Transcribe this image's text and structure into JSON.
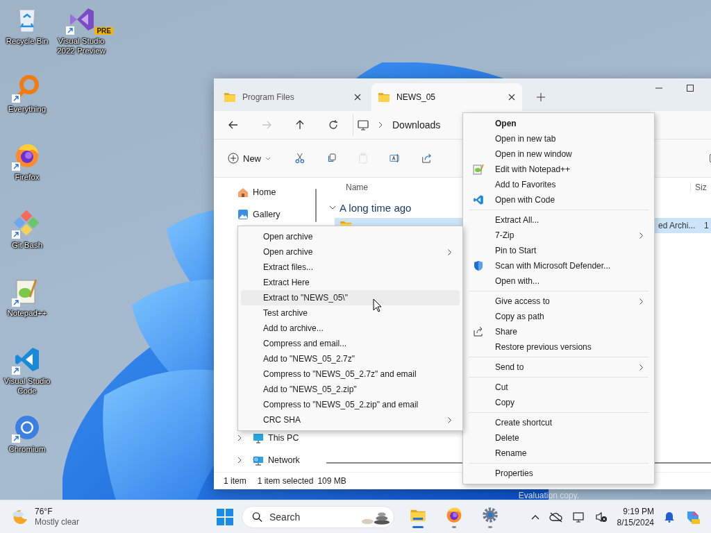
{
  "desktop": {
    "columns": [
      [
        {
          "label": "Recycle Bin",
          "kind": "recycle",
          "shortcut": false
        },
        {
          "label": "Everything",
          "kind": "everything",
          "shortcut": true
        },
        {
          "label": "Firefox",
          "kind": "firefox",
          "shortcut": true
        },
        {
          "label": "Git Bash",
          "kind": "git",
          "shortcut": true
        },
        {
          "label": "Notepad++",
          "kind": "notepad",
          "shortcut": true
        },
        {
          "label": "Visual Studio Code",
          "kind": "vscode",
          "shortcut": true
        },
        {
          "label": "Chromium",
          "kind": "chromium",
          "shortcut": true
        }
      ],
      [
        {
          "label": "Visual Studio 2022 Preview",
          "kind": "vs",
          "shortcut": true,
          "badge": "PRE"
        }
      ]
    ],
    "watermark": "Evaluation copy."
  },
  "explorer": {
    "tabs": [
      {
        "label": "Program Files",
        "selected": false
      },
      {
        "label": "NEWS_05",
        "selected": true
      }
    ],
    "nav_buttons": [
      {
        "kind": "back",
        "disabled": false
      },
      {
        "kind": "forward",
        "disabled": true
      },
      {
        "kind": "up",
        "disabled": false
      },
      {
        "kind": "refresh",
        "disabled": false
      }
    ],
    "crumbs": [
      "Downloads"
    ],
    "toolbar": {
      "new": "New",
      "tools": [
        {
          "kind": "cut",
          "disabled": false
        },
        {
          "kind": "copy",
          "disabled": false
        },
        {
          "kind": "paste",
          "disabled": true
        },
        {
          "kind": "rename",
          "disabled": false
        },
        {
          "kind": "share",
          "disabled": false
        }
      ]
    },
    "nav": {
      "top": [
        {
          "label": "Home",
          "kind": "home"
        },
        {
          "label": "Gallery",
          "kind": "gallery"
        }
      ],
      "bottom": [
        {
          "label": "This PC",
          "kind": "pc"
        },
        {
          "label": "Network",
          "kind": "network"
        }
      ]
    },
    "list": {
      "columns": [
        "Name",
        "Siz"
      ],
      "group": {
        "label": "A long time ago",
        "expanded": true
      },
      "rows": [
        {
          "type": "ed Archi...",
          "size": "1",
          "selected": true
        }
      ]
    },
    "status": [
      "1 item",
      "1 item selected",
      "109 MB"
    ]
  },
  "context_menu": {
    "items": [
      {
        "label": "Open",
        "kind": "default"
      },
      {
        "label": "Open in new tab",
        "kind": "item"
      },
      {
        "label": "Open in new window",
        "kind": "item"
      },
      {
        "label": "Edit with Notepad++",
        "kind": "item"
      },
      {
        "label": "Add to Favorites",
        "kind": "item"
      },
      {
        "label": "Open with Code",
        "kind": "item"
      },
      {
        "kind": "separator"
      },
      {
        "label": "Extract All...",
        "kind": "item"
      },
      {
        "label": "7-Zip",
        "kind": "submenu"
      },
      {
        "label": "Pin to Start",
        "kind": "item"
      },
      {
        "label": "Scan with Microsoft Defender...",
        "kind": "item"
      },
      {
        "label": "Open with...",
        "kind": "item"
      },
      {
        "kind": "separator"
      },
      {
        "label": "Give access to",
        "kind": "submenu"
      },
      {
        "label": "Copy as path",
        "kind": "item"
      },
      {
        "label": "Share",
        "kind": "item"
      },
      {
        "label": "Restore previous versions",
        "kind": "item"
      },
      {
        "kind": "separator"
      },
      {
        "label": "Send to",
        "kind": "submenu"
      },
      {
        "kind": "separator"
      },
      {
        "label": "Cut",
        "kind": "item"
      },
      {
        "label": "Copy",
        "kind": "item"
      },
      {
        "kind": "separator"
      },
      {
        "label": "Create shortcut",
        "kind": "item"
      },
      {
        "label": "Delete",
        "kind": "item"
      },
      {
        "label": "Rename",
        "kind": "item"
      },
      {
        "kind": "separator"
      },
      {
        "label": "Properties",
        "kind": "item"
      }
    ]
  },
  "zip_submenu": {
    "items": [
      {
        "label": "Open archive",
        "kind": "item",
        "selected": false
      },
      {
        "label": "Open archive",
        "kind": "submenu",
        "selected": false
      },
      {
        "label": "Extract files...",
        "kind": "item",
        "selected": false
      },
      {
        "label": "Extract Here",
        "kind": "item",
        "selected": false
      },
      {
        "label": "Extract to \"NEWS_05\\\"",
        "kind": "item",
        "selected": true
      },
      {
        "label": "Test archive",
        "kind": "item",
        "selected": false
      },
      {
        "label": "Add to archive...",
        "kind": "item",
        "selected": false
      },
      {
        "label": "Compress and email...",
        "kind": "item",
        "selected": false
      },
      {
        "label": "Add to \"NEWS_05_2.7z\"",
        "kind": "item",
        "selected": false
      },
      {
        "label": "Compress to \"NEWS_05_2.7z\" and email",
        "kind": "item",
        "selected": false
      },
      {
        "label": "Add to \"NEWS_05_2.zip\"",
        "kind": "item",
        "selected": false
      },
      {
        "label": "Compress to \"NEWS_05_2.zip\" and email",
        "kind": "item",
        "selected": false
      },
      {
        "label": "CRC SHA",
        "kind": "submenu",
        "selected": false
      }
    ]
  },
  "taskbar": {
    "weather": {
      "temp": "76°F",
      "condition": "Mostly clear"
    },
    "search": {
      "placeholder": "Search"
    },
    "apps": [
      {
        "kind": "explorer",
        "selected": true
      },
      {
        "kind": "firefox",
        "selected": false
      },
      {
        "kind": "settings",
        "selected": false
      }
    ],
    "tray": {
      "time": "9:19 PM",
      "date": "8/15/2024"
    }
  }
}
